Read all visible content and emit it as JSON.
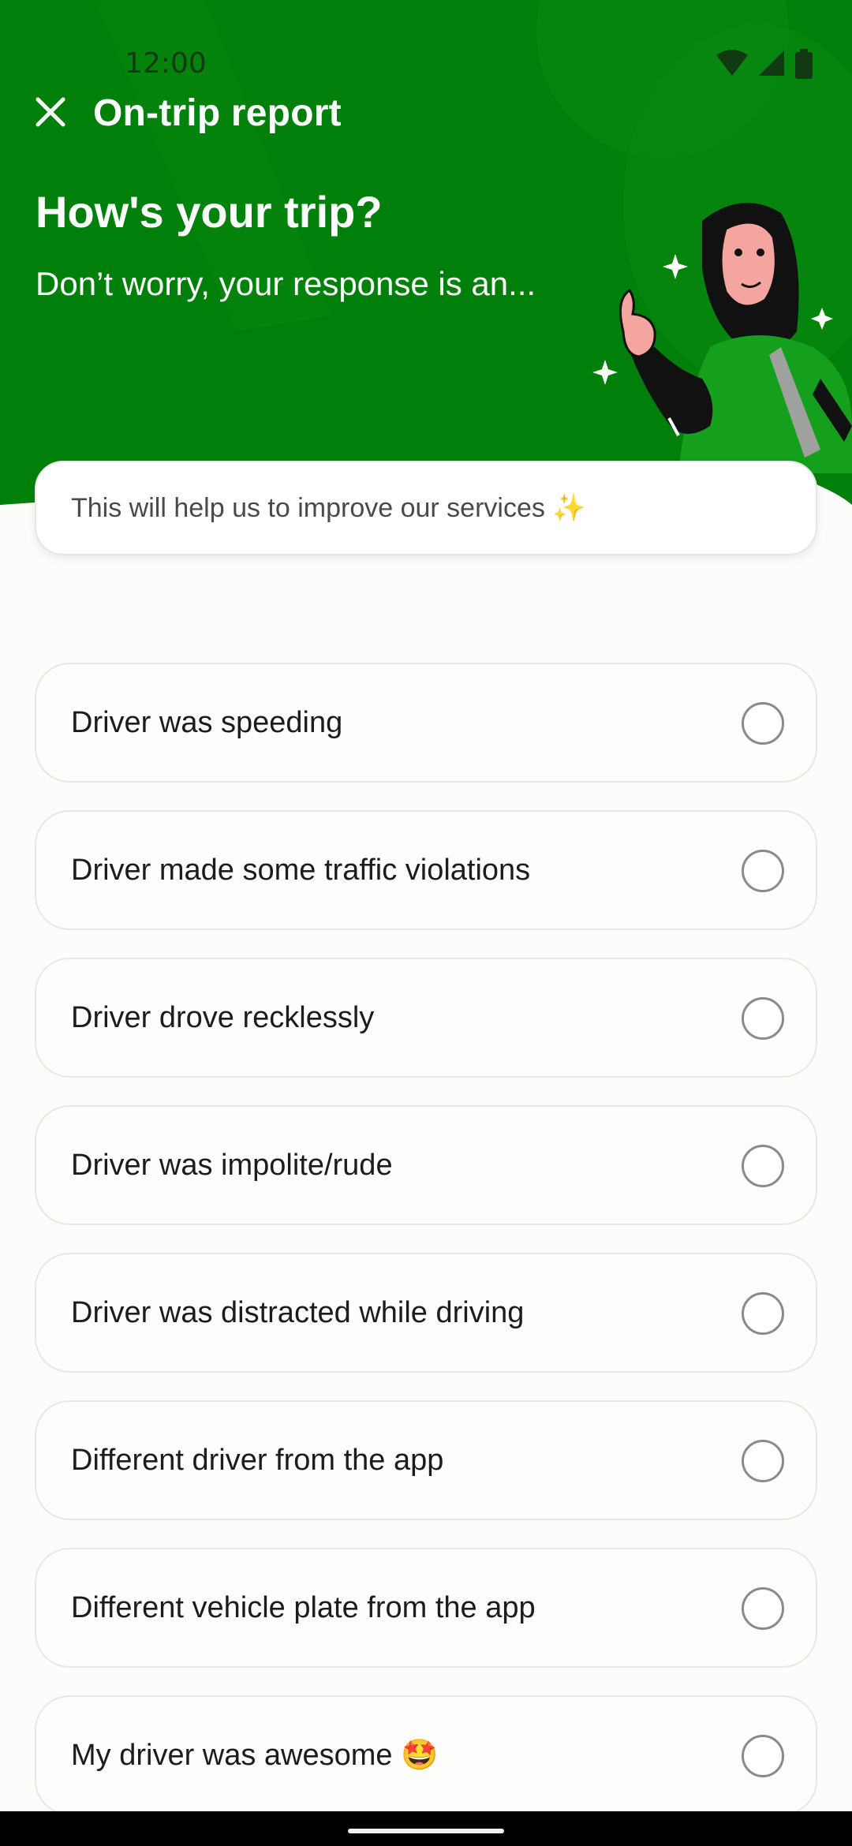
{
  "status": {
    "time": "12:00"
  },
  "appbar": {
    "title": "On-trip report",
    "close_icon": "close-icon"
  },
  "hero": {
    "title": "How's your trip?",
    "subtitle": "Don’t worry, your response is an..."
  },
  "info": {
    "text": "This will help us to improve our services ✨"
  },
  "options": [
    {
      "label": "Driver was speeding",
      "selected": false
    },
    {
      "label": "Driver made some traffic violations",
      "selected": false
    },
    {
      "label": "Driver drove recklessly",
      "selected": false
    },
    {
      "label": "Driver was impolite/rude",
      "selected": false
    },
    {
      "label": "Driver was distracted while driving",
      "selected": false
    },
    {
      "label": "Different driver from the app",
      "selected": false
    },
    {
      "label": "Different vehicle plate from the app",
      "selected": false
    },
    {
      "label": "My driver was awesome 🤩",
      "selected": false
    }
  ],
  "colors": {
    "brand": "#00800a",
    "background": "#fcfcfa"
  }
}
